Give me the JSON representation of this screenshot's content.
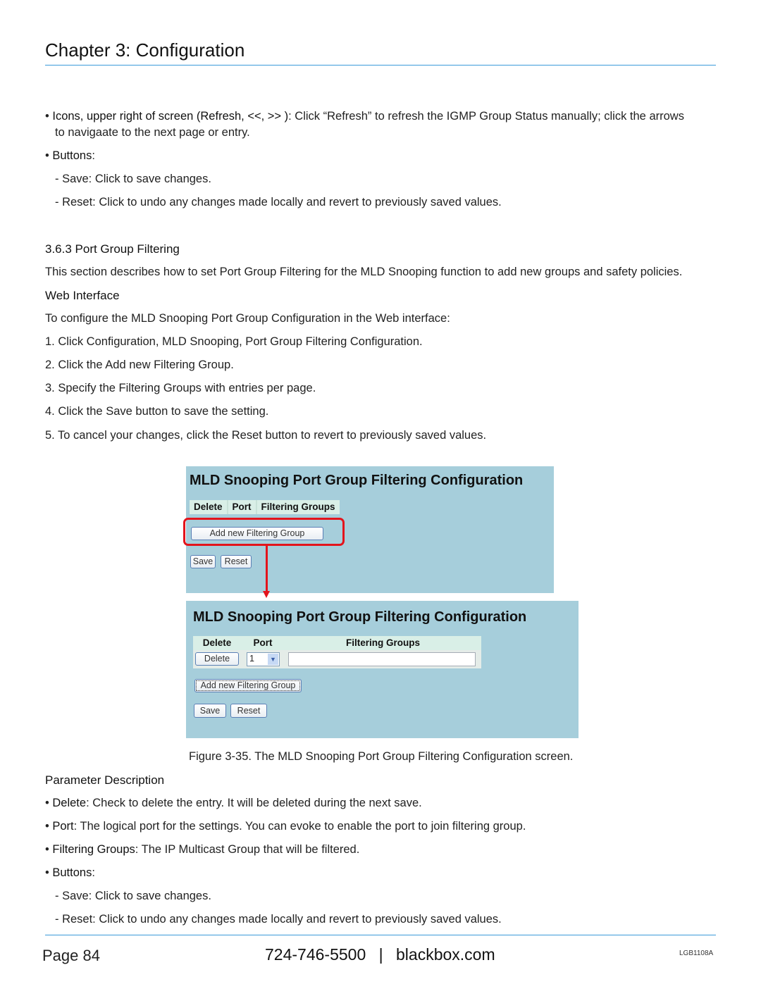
{
  "header": {
    "chapter": "Chapter 3: Configuration"
  },
  "intro": {
    "icons_bold": "Icons, upper right of screen (Refresh, <<, >> )",
    "icons_text": ": Click “Refresh” to refresh the IGMP Group Status manually; click the arrows",
    "icons_text2": "to navigaate to the next page or entry.",
    "buttons_bold": "Buttons",
    "save": "- Save: Click to save changes.",
    "reset": "- Reset: Click to undo any changes made locally and revert to previously saved values."
  },
  "section": {
    "title": "3.6.3 Port Group Filtering",
    "desc": "This section describes how to set Port Group Filtering for the MLD Snooping function to add new groups and safety policies.",
    "web_interface": "Web Interface",
    "lead": "To configure the MLD Snooping Port Group Configuration in the Web interface:",
    "steps": [
      "1. Click Configuration, MLD Snooping, Port Group Filtering Configuration.",
      "2. Click the Add new Filtering Group.",
      "3. Specify the Filtering Groups with entries per page.",
      "4. Click the Save button to save the setting.",
      "5. To cancel your changes, click the Reset button to revert to previously saved values."
    ]
  },
  "figure": {
    "panel1": {
      "title": "MLD Snooping Port Group Filtering Configuration",
      "headers": [
        "Delete",
        "Port",
        "Filtering Groups"
      ],
      "add_button": "Add new Filtering Group",
      "save": "Save",
      "reset": "Reset"
    },
    "panel2": {
      "title": "MLD Snooping Port Group Filtering Configuration",
      "headers": [
        "Delete",
        "Port",
        "Filtering Groups"
      ],
      "delete_button": "Delete",
      "port_value": "1",
      "filter_value": "",
      "add_button": "Add new Filtering Group",
      "save": "Save",
      "reset": "Reset"
    },
    "caption": "Figure 3-35. The MLD Snooping Port Group Filtering Configuration screen."
  },
  "params": {
    "title": "Parameter Description",
    "items": [
      {
        "bold": "Delete",
        "text": ": Check to delete the entry. It will be deleted during the next save."
      },
      {
        "bold": "Port",
        "text": ": The logical port for the settings. You can evoke to enable the port to join filtering group."
      },
      {
        "bold": "Filtering Groups",
        "text": ": The IP Multicast Group that will be filtered."
      },
      {
        "bold": "Buttons",
        "text": ":"
      }
    ],
    "save": "- Save: Click to save changes.",
    "reset": "- Reset: Click to undo any changes made locally and revert to previously saved values."
  },
  "footer": {
    "page": "Page 84",
    "phone": "724-746-5500",
    "sep": "|",
    "site": "blackbox.com",
    "code": "LGB1108A"
  }
}
